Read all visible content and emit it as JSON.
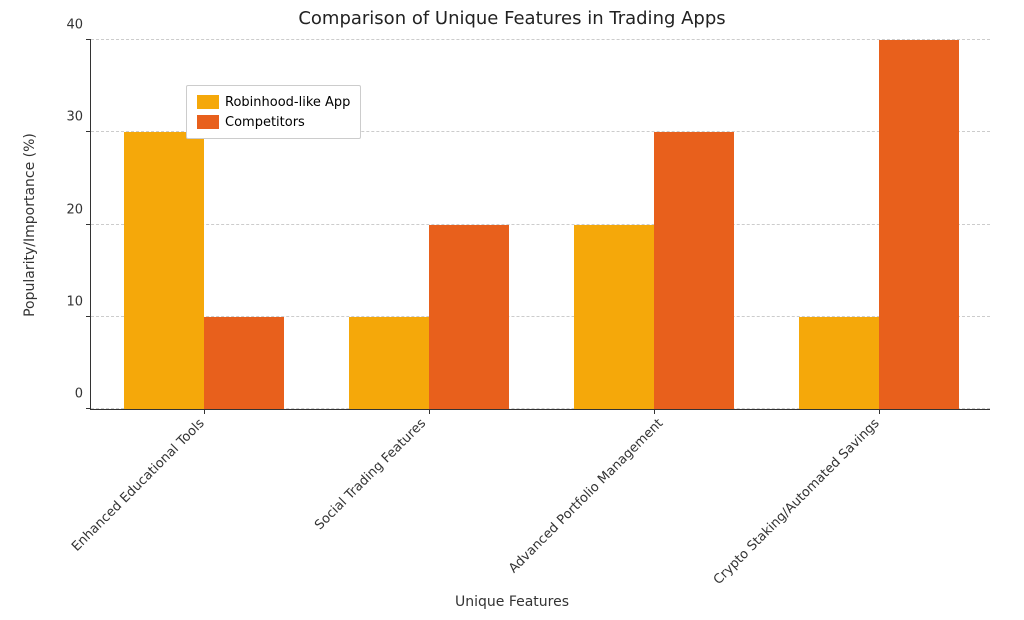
{
  "chart_data": {
    "type": "bar",
    "title": "Comparison of Unique Features in Trading Apps",
    "xlabel": "Unique Features",
    "ylabel": "Popularity/Importance (%)",
    "ylim": [
      0,
      40
    ],
    "yticks": [
      0,
      10,
      20,
      30,
      40
    ],
    "categories": [
      "Enhanced Educational Tools",
      "Social Trading Features",
      "Advanced Portfolio Management",
      "Crypto Staking/Automated Savings"
    ],
    "series": [
      {
        "name": "Robinhood-like App",
        "values": [
          30,
          10,
          20,
          10
        ],
        "color": "#f5a80a"
      },
      {
        "name": "Competitors",
        "values": [
          10,
          20,
          30,
          40
        ],
        "color": "#e8601c"
      }
    ]
  }
}
